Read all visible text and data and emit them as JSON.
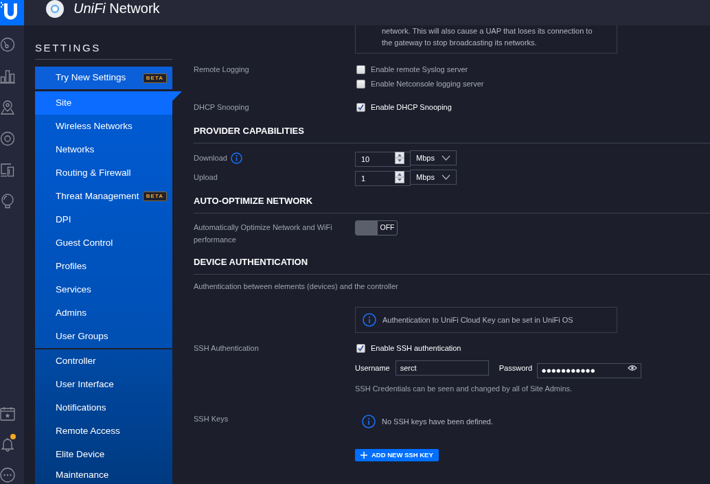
{
  "header": {
    "title": "*UniFi* Network"
  },
  "alerts": {
    "unread": true
  },
  "sidebar": {
    "title": "SETTINGS",
    "groups": [
      {
        "items": [
          {
            "label": "Try New Settings",
            "badge": "BETA",
            "selected": false
          }
        ]
      },
      {
        "items": [
          {
            "label": "Site",
            "selected": true
          },
          {
            "label": "Wireless Networks",
            "selected": false
          },
          {
            "label": "Networks",
            "selected": false
          },
          {
            "label": "Routing & Firewall",
            "selected": false
          },
          {
            "label": "Threat Management",
            "badge": "BETA",
            "selected": false
          },
          {
            "label": "DPI",
            "selected": false
          },
          {
            "label": "Guest Control",
            "selected": false
          },
          {
            "label": "Profiles",
            "selected": false
          },
          {
            "label": "Services",
            "selected": false
          },
          {
            "label": "Admins",
            "selected": false
          },
          {
            "label": "User Groups",
            "selected": false
          }
        ]
      },
      {
        "items": [
          {
            "label": "Controller",
            "selected": false
          },
          {
            "label": "User Interface",
            "selected": false
          },
          {
            "label": "Notifications",
            "selected": false
          },
          {
            "label": "Remote Access",
            "selected": false
          },
          {
            "label": "Elite Device",
            "selected": false
          },
          {
            "label": "Maintenance",
            "selected": false
          }
        ]
      }
    ]
  },
  "sections": [
    {
      "rows": [
        {
          "kind": "notice",
          "lines": [
            "network. This will also cause a UAP that loses its connection to",
            "the gateway to stop broadcasting its networks."
          ]
        },
        {
          "kind": "checks",
          "label": "Remote Logging",
          "options": [
            {
              "label": "Enable remote Syslog server",
              "checked": false
            },
            {
              "label": "Enable Netconsole logging server",
              "checked": false
            }
          ]
        },
        {
          "kind": "checks",
          "label": "DHCP Snooping",
          "options": [
            {
              "label": "Enable DHCP Snooping",
              "checked": true
            }
          ]
        }
      ]
    },
    {
      "title": "PROVIDER CAPABILITIES",
      "rows": [
        {
          "kind": "rate",
          "label": "Download",
          "info": true,
          "value": "10",
          "unit": "Mbps"
        },
        {
          "kind": "rate",
          "label": "Upload",
          "info": false,
          "value": "1",
          "unit": "Mbps"
        }
      ]
    },
    {
      "title": "AUTO-OPTIMIZE NETWORK",
      "rows": [
        {
          "kind": "toggle",
          "label": "Automatically Optimize Network and WiFi performance",
          "on": false,
          "state_text": "OFF"
        }
      ]
    },
    {
      "title": "DEVICE AUTHENTICATION",
      "description": "Authentication between elements (devices) and the controller",
      "rows": [
        {
          "kind": "banner",
          "text": "Authentication to UniFi Cloud Key can be set in UniFi OS"
        },
        {
          "kind": "credentials",
          "label": "SSH Authentication",
          "option": {
            "label": "Enable SSH authentication",
            "checked": true
          },
          "username": {
            "label": "Username",
            "value": "serct"
          },
          "password": {
            "label": "Password",
            "value": "●●●●●●●●●●●"
          },
          "hint": "SSH Credentials can be seen and changed by all of Site Admins."
        },
        {
          "kind": "keys",
          "label": "SSH Keys",
          "message": "No SSH keys have been defined.",
          "button": "ADD NEW SSH KEY"
        }
      ]
    }
  ]
}
